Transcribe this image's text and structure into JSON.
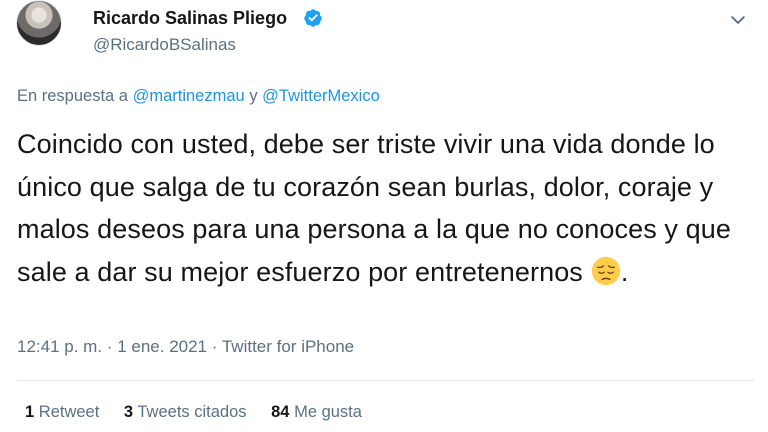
{
  "author": {
    "display_name": "Ricardo Salinas Pliego",
    "handle": "@RicardoBSalinas",
    "verified": true,
    "avatar_icon": "profile-photo"
  },
  "reply": {
    "prefix": "En respuesta a",
    "mention_1": "@martinezmau",
    "connector": "y",
    "mention_2": "@TwitterMexico"
  },
  "tweet": {
    "text": "Coincido con usted, debe ser triste vivir una vida donde lo único que salga de tu corazón sean burlas, dolor, coraje y malos deseos para una persona a la que no conoces y que sale a dar su mejor esfuerzo por entretenernos",
    "trailing_punct": ".",
    "emoji": "pensive-face"
  },
  "meta": {
    "time": "12:41 p. m.",
    "sep_1": "·",
    "date": "1 ene. 2021",
    "sep_2": "·",
    "source": "Twitter for iPhone"
  },
  "stats": {
    "retweets_count": "1",
    "retweets_label": "Retweet",
    "quotes_count": "3",
    "quotes_label": "Tweets citados",
    "likes_count": "84",
    "likes_label": "Me gusta"
  },
  "colors": {
    "link": "#1b95e0",
    "secondary_text": "#5b7083",
    "verified_badge": "#1da1f2"
  }
}
